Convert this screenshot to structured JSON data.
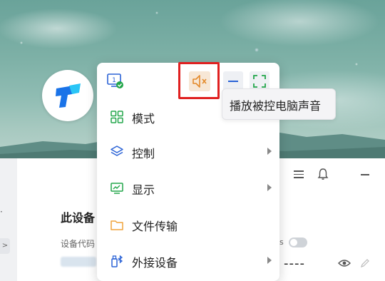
{
  "popup": {
    "toolbar": {
      "monitor_number": "1",
      "mute_icon": "speaker-mute-icon",
      "minimize_icon": "minimize-icon",
      "fullscreen_icon": "fullscreen-icon"
    },
    "items": [
      {
        "label": "模式",
        "icon": "grid-icon",
        "has_submenu": false
      },
      {
        "label": "控制",
        "icon": "layers-icon",
        "has_submenu": true
      },
      {
        "label": "显示",
        "icon": "monitor-chart-icon",
        "has_submenu": true
      },
      {
        "label": "文件传输",
        "icon": "folder-icon",
        "has_submenu": false
      },
      {
        "label": "外接设备",
        "icon": "usb-bluetooth-icon",
        "has_submenu": true
      }
    ]
  },
  "tooltip": {
    "text": "播放被控电脑声音"
  },
  "background_app": {
    "section_title": "此设备",
    "code_label": "设备代码",
    "partial_s": "s",
    "hidden_password": "----",
    "left_tab_glyph": ">"
  },
  "colors": {
    "accent_blue": "#2a62d6",
    "mute_orange": "#e48a2b",
    "highlight_red": "#e02020",
    "green": "#22a64a"
  }
}
